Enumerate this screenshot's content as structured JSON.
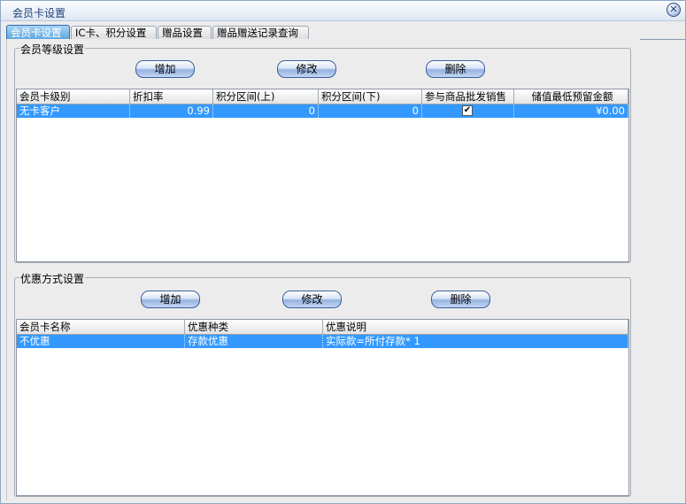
{
  "window": {
    "title": "会员卡设置"
  },
  "tabs": [
    {
      "label": "会员卡设置"
    },
    {
      "label": "IC卡、积分设置"
    },
    {
      "label": "赠品设置"
    },
    {
      "label": "赠品赠送记录查询"
    }
  ],
  "level_section": {
    "title": "会员等级设置",
    "buttons": {
      "add": "增加",
      "edit": "修改",
      "delete": "删除"
    },
    "columns": [
      "会员卡级别",
      "折扣率",
      "积分区间(上)",
      "积分区间(下)",
      "参与商品批发销售",
      "储值最低预留金额"
    ],
    "rows": [
      {
        "level": "无卡客户",
        "discount": "0.99",
        "points_upper": "0",
        "points_lower": "0",
        "wholesale_checked": true,
        "min_reserve": "¥0.00"
      }
    ]
  },
  "discount_section": {
    "title": "优惠方式设置",
    "buttons": {
      "add": "增加",
      "edit": "修改",
      "delete": "删除"
    },
    "columns": [
      "会员卡名称",
      "优惠种类",
      "优惠说明"
    ],
    "rows": [
      {
        "name": "不优惠",
        "type": "存款优惠",
        "desc": "实际款=所付存款* 1"
      }
    ]
  }
}
